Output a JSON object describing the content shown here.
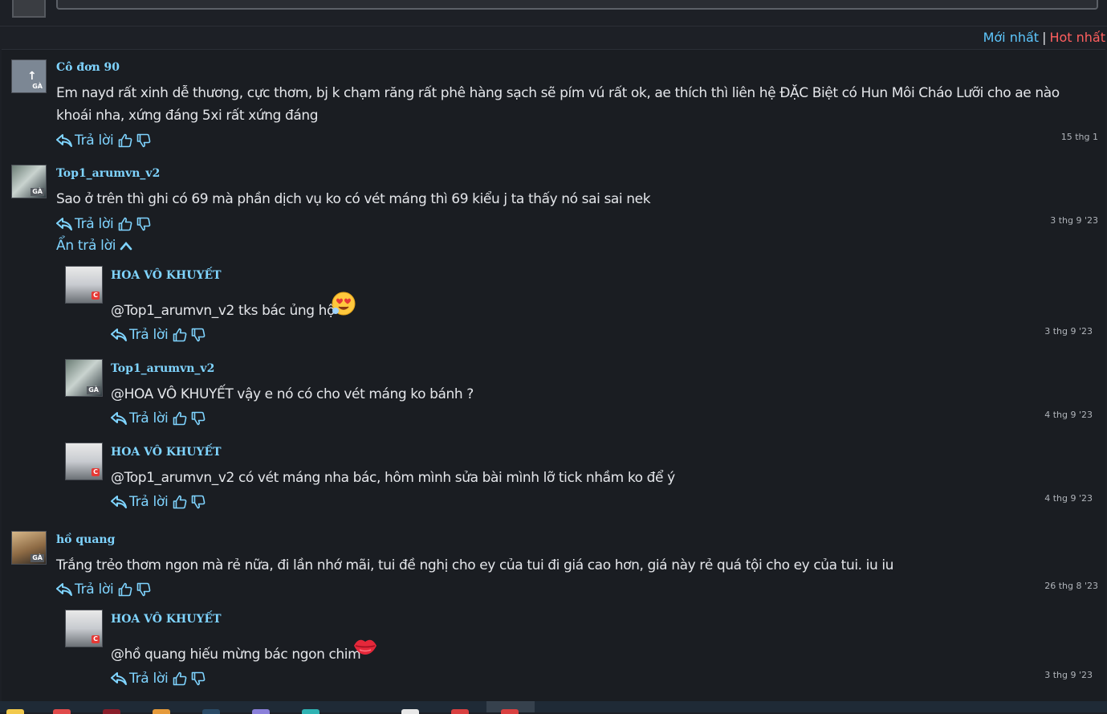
{
  "sort": {
    "newest": "Mới nhất",
    "separator": "|",
    "hot": "Hot nhất"
  },
  "labels": {
    "reply": "Trả lời",
    "hide_replies": "Ẩn trả lời"
  },
  "avatar_badges": {
    "ga": "GÀ",
    "c": "C"
  },
  "comments": [
    {
      "author": "Cô đơn 90",
      "text": "Em nayd rất xinh dễ thương, cực thơm, bj k chạm răng rất phê hàng sạch sẽ pím vú rất ok, ae thích thì liên hệ ĐẶC Biệt có Hun Môi Cháo Lưỡi cho ae nào khoái nha, xứng đáng 5xi rất xứng đáng",
      "time": "15 thg 1"
    },
    {
      "author": "Top1_arumvn_v2",
      "text": "Sao ở trên thì ghi có 69 mà phần dịch vụ ko có vét máng thì 69 kiểu j ta thấy nó sai sai nek",
      "time": "3 thg 9 '23",
      "replies": [
        {
          "author": "HOA VÔ KHUYẾT",
          "text": "@Top1_arumvn_v2 tks bác ủng hộ",
          "time": "3 thg 9 '23",
          "emoji": "heart-eyes-emoji"
        },
        {
          "author": "Top1_arumvn_v2",
          "text": "@HOA VÔ KHUYẾT vậy e nó có cho vét máng ko bánh ?",
          "time": "4 thg 9 '23"
        },
        {
          "author": "HOA VÔ KHUYẾT",
          "text": "@Top1_arumvn_v2 có vét máng nha bác, hôm mình sửa bài mình lỡ tick nhầm ko để ý",
          "time": "4 thg 9 '23"
        }
      ]
    },
    {
      "author": "hồ quang",
      "text": "Trắng trẻo thơm ngon mà rẻ nữa, đi lần nhớ mãi, tui đề nghị cho ey của tui đi giá cao hơn, giá này rẻ quá tội cho ey của tui. iu iu",
      "time": "26 thg 8 '23",
      "replies": [
        {
          "author": "HOA VÔ KHUYẾT",
          "text": "@hồ quang hiếu mừng bác ngon chim",
          "time": "3 thg 9 '23",
          "emoji": "lips-emoji"
        }
      ]
    }
  ],
  "colors": {
    "accent": "#7fd4ff",
    "hot": "#ff5f5f",
    "background": "#1a1d22",
    "text": "#e4e6ea"
  }
}
